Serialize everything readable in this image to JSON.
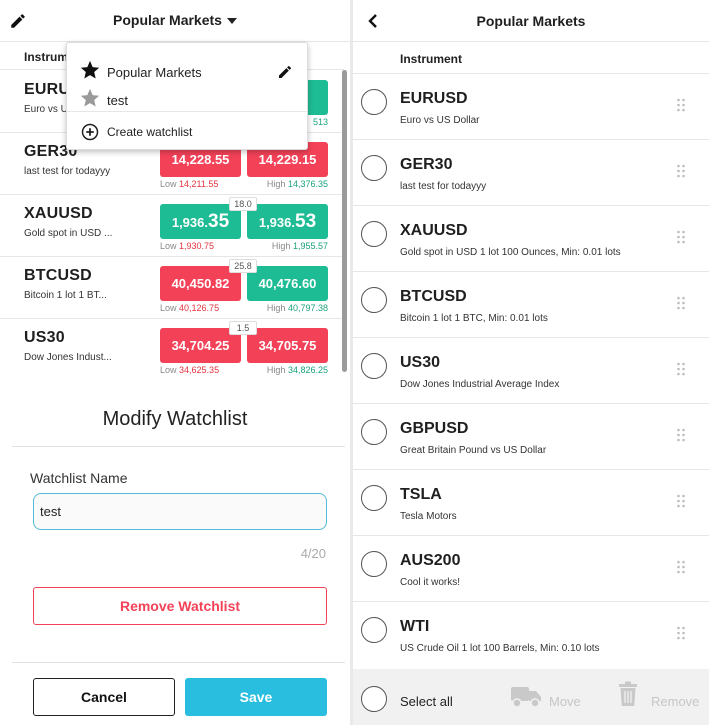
{
  "left": {
    "header_title": "Popular Markets",
    "column_header": "Instrument",
    "rows": [
      {
        "symbol": "EURUSD",
        "desc": "Euro vs US Dollar",
        "ask_fragment": "1",
        "high_fragment": "513"
      },
      {
        "symbol": "GER30",
        "desc": "last test for todayyy",
        "bid_main": "14,228.",
        "bid_big": "55",
        "ask_main": "14,229.",
        "ask_big": "15",
        "spread": "",
        "low_label": "Low",
        "low": "14,211.55",
        "high_label": "High",
        "high": "14,376.35",
        "bid_color": "red",
        "ask_color": "red"
      },
      {
        "symbol": "XAUUSD",
        "desc": "Gold spot in USD ...",
        "bid_main": "1,936.",
        "bid_big": "35",
        "ask_main": "1,936.",
        "ask_big": "53",
        "spread": "18.0",
        "low_label": "Low",
        "low": "1,930.75",
        "high_label": "High",
        "high": "1,955.57",
        "bid_color": "green",
        "ask_color": "green"
      },
      {
        "symbol": "BTCUSD",
        "desc": "Bitcoin 1 lot 1 BT...",
        "bid_main": "40,450.",
        "bid_big": "82",
        "ask_main": "40,476.",
        "ask_big": "60",
        "spread": "25.8",
        "low_label": "Low",
        "low": "40,126.75",
        "high_label": "High",
        "high": "40,797.38",
        "bid_color": "red",
        "ask_color": "green"
      },
      {
        "symbol": "US30",
        "desc": "Dow Jones Indust...",
        "bid_main": "34,704.",
        "bid_big": "25",
        "ask_main": "34,705.",
        "ask_big": "75",
        "spread": "1.5",
        "low_label": "Low",
        "low": "34,625.35",
        "high_label": "High",
        "high": "34,826.25",
        "bid_color": "red",
        "ask_color": "red"
      }
    ],
    "dropdown": {
      "items": [
        {
          "label": "Popular Markets",
          "icon": "star-filled-icon"
        },
        {
          "label": "test",
          "icon": "star-gray-icon"
        }
      ],
      "create_label": "Create watchlist"
    },
    "modal": {
      "title": "Modify Watchlist",
      "name_label": "Watchlist Name",
      "name_value": "test",
      "counter": "4/20",
      "remove_label": "Remove Watchlist",
      "cancel_label": "Cancel",
      "save_label": "Save"
    }
  },
  "right": {
    "header_title": "Popular Markets",
    "column_header": "Instrument",
    "rows": [
      {
        "symbol": "EURUSD",
        "desc": "Euro vs US Dollar"
      },
      {
        "symbol": "GER30",
        "desc": "last test for todayyy"
      },
      {
        "symbol": "XAUUSD",
        "desc": "Gold spot in USD 1 lot 100 Ounces, Min: 0.01 lots"
      },
      {
        "symbol": "BTCUSD",
        "desc": "Bitcoin 1 lot 1 BTC, Min: 0.01 lots"
      },
      {
        "symbol": "US30",
        "desc": "Dow Jones Industrial Average Index"
      },
      {
        "symbol": "GBPUSD",
        "desc": "Great Britain Pound vs US Dollar"
      },
      {
        "symbol": "TSLA",
        "desc": "Tesla Motors"
      },
      {
        "symbol": "AUS200",
        "desc": "Cool it works!"
      },
      {
        "symbol": "WTI",
        "desc": "US Crude Oil 1 lot 100 Barrels, Min: 0.10 lots"
      }
    ],
    "footer": {
      "select_all": "Select all",
      "move": "Move",
      "remove": "Remove"
    }
  },
  "colors": {
    "red": "#f34258",
    "green": "#1ebc94",
    "accent": "#29bedf",
    "disabled": "#c6c6c6"
  }
}
